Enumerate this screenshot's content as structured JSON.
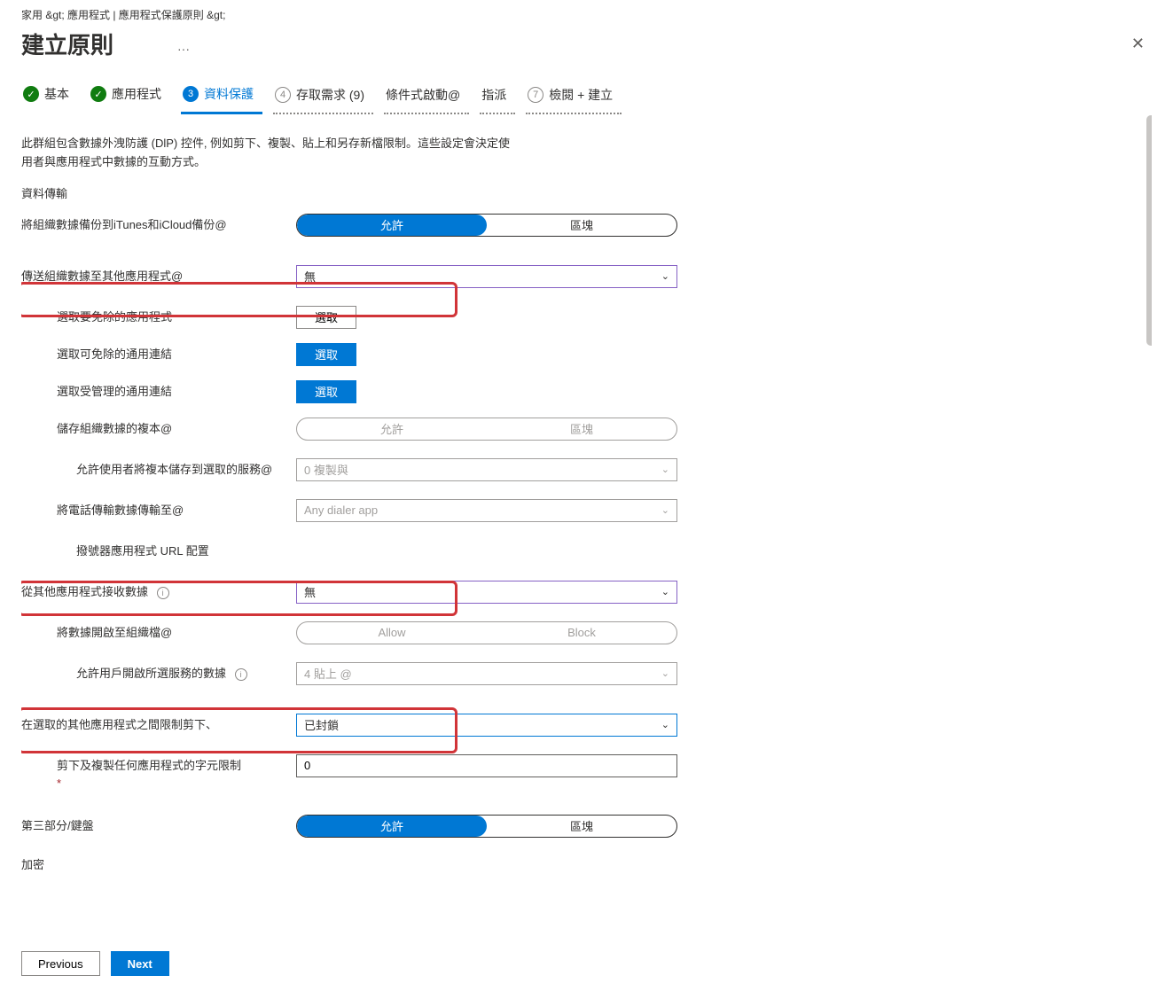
{
  "breadcrumb": "家用 &gt;  應用程式 | 應用程式保護原則 &gt;",
  "title": "建立原則",
  "tabs": {
    "t1": "基本",
    "t2": "應用程式",
    "t3": "資料保護",
    "t4": "存取需求 (9)",
    "t5": "條件式啟動@",
    "t6": "指派",
    "t7": "檢閱 + 建立",
    "n3": "3",
    "n4": "4",
    "n7": "7"
  },
  "desc": "此群組包含數據外洩防護 (DlP) 控件, 例如剪下、複製、貼上和另存新檔限制。這些設定會決定使用者與應用程式中數據的互動方式。",
  "section_data_transfer": "資料傳輸",
  "rows": {
    "backup_label": "將組織數據備份到iTunes和iCloud備份@",
    "allow": "允許",
    "block": "區塊",
    "send_label": "傳送組織數據至其他應用程式@",
    "none": "無",
    "exempt_apps": "選取要免除的應用程式",
    "exempt_links": "選取可免除的通用連結",
    "managed_links": "選取受管理的通用連結",
    "select_btn": "選取",
    "save_copies": "儲存組織數據的複本@",
    "allow_save_label": "允許使用者將複本儲存到選取的服務@",
    "allow_save_value": "0 複製與",
    "dialer_label": "將電話傳輸數據傳輸至@",
    "dialer_value": "Any dialer app",
    "dialer_url": "撥號器應用程式 URL 配置",
    "receive_label": "從其他應用程式接收數據",
    "open_org_label": "將數據開啟至組織檔@",
    "allow_en": "Allow",
    "block_en": "Block",
    "open_services_label": "允許用戶開啟所選服務的數據",
    "open_services_value": "4 貼上 @",
    "restrict_cut_label": "在選取的其他應用程式之間限制剪下、",
    "restrict_cut_value": "已封鎖",
    "char_limit_label": "剪下及複製任何應用程式的字元限制",
    "char_limit_value": "0",
    "keyboard_label": "第三部分/鍵盤",
    "encrypt_label": "加密"
  },
  "footer": {
    "prev": "Previous",
    "next": "Next"
  }
}
